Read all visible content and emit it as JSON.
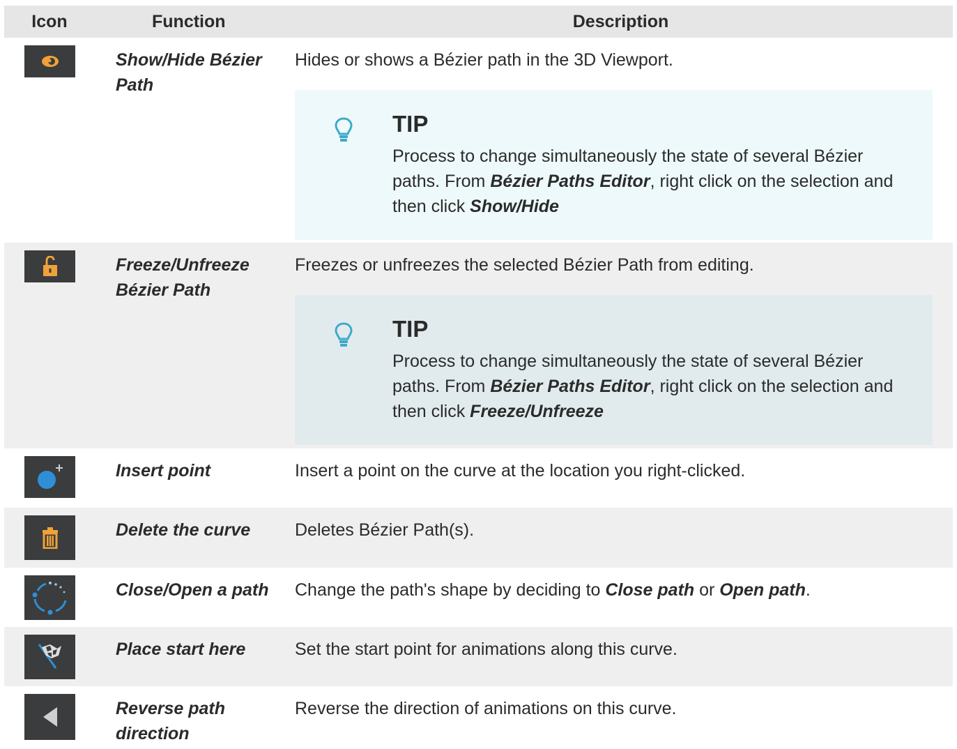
{
  "headers": {
    "icon": "Icon",
    "function": "Function",
    "description": "Description"
  },
  "rows": [
    {
      "icon": "eye-icon",
      "function": "Show/Hide Bézier Path",
      "description": "Hides or shows a Bézier path in the 3D Viewport.",
      "tip": {
        "title": "TIP",
        "text_1": "Process to change simultaneously the state of several Bézier paths. From ",
        "bold_1": "Bézier Paths Editor",
        "text_2": ", right click on the selection and then click ",
        "bold_2": "Show/Hide"
      }
    },
    {
      "icon": "unlock-icon",
      "function": "Freeze/Unfreeze Bézier Path",
      "description": "Freezes or unfreezes the selected Bézier Path from editing.",
      "tip": {
        "title": "TIP",
        "text_1": "Process to change simultaneously the state of several Bézier paths. From ",
        "bold_1": "Bézier Paths Editor",
        "text_2": ", right click on the selection and then click ",
        "bold_2": "Freeze/Unfreeze"
      }
    },
    {
      "icon": "insert-point-icon",
      "function": "Insert point",
      "description": "Insert a point on the curve at the location you right-clicked."
    },
    {
      "icon": "trash-icon",
      "function": "Delete the curve",
      "description": "Deletes Bézier Path(s)."
    },
    {
      "icon": "close-open-path-icon",
      "function": "Close/Open a path",
      "description_1": "Change the path's shape by deciding to ",
      "bold_1": "Close path",
      "description_2": " or ",
      "bold_2": "Open path",
      "description_3": "."
    },
    {
      "icon": "start-flag-icon",
      "function": "Place start here",
      "description": "Set the start point for animations along this curve."
    },
    {
      "icon": "reverse-arrow-icon",
      "function": "Reverse path direction",
      "description": "Reverse the direction of animations on this curve."
    }
  ],
  "colors": {
    "accent": "#f0a23a",
    "tip_icon": "#3fa9c9",
    "icon_bg": "#3b3c3d",
    "point_blue": "#2f8fd6"
  }
}
